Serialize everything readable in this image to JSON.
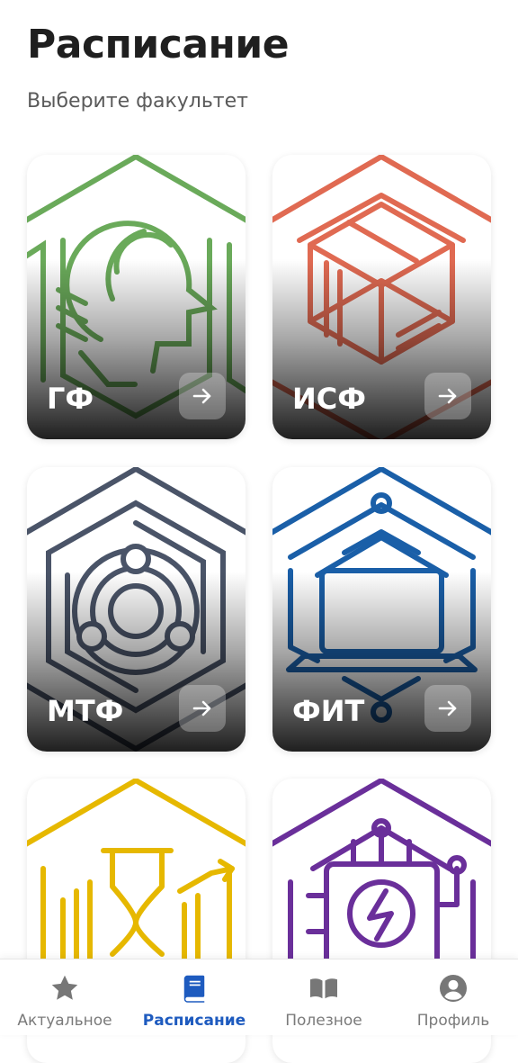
{
  "header": {
    "title": "Расписание",
    "subtitle": "Выберите факультет"
  },
  "faculties": [
    {
      "label": "ГФ",
      "color": "#6aaa5a",
      "icon": "head-profile-icon"
    },
    {
      "label": "ИСФ",
      "color": "#e06a52",
      "icon": "cube-icon"
    },
    {
      "label": "МТФ",
      "color": "#4a5468",
      "icon": "gear-ring-icon"
    },
    {
      "label": "ФИТ",
      "color": "#1a5fa8",
      "icon": "laptop-icon"
    },
    {
      "label": "",
      "color": "#e6b800",
      "icon": "hourglass-chart-icon"
    },
    {
      "label": "",
      "color": "#6a2f9a",
      "icon": "chip-lightning-icon"
    }
  ],
  "bottom_nav": {
    "items": [
      {
        "label": "Актуальное",
        "icon": "star-icon",
        "active": false
      },
      {
        "label": "Расписание",
        "icon": "book-icon",
        "active": true
      },
      {
        "label": "Полезное",
        "icon": "open-book-icon",
        "active": false
      },
      {
        "label": "Профиль",
        "icon": "user-icon",
        "active": false
      }
    ],
    "active_color": "#1e5bbf",
    "inactive_color": "#7a7a7a"
  }
}
